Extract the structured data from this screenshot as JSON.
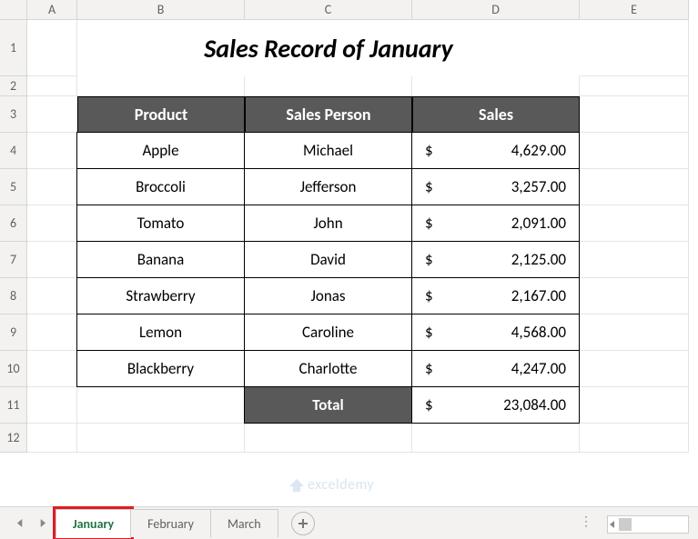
{
  "columns": [
    "A",
    "B",
    "C",
    "D",
    "E"
  ],
  "rows": [
    "1",
    "2",
    "3",
    "4",
    "5",
    "6",
    "7",
    "8",
    "9",
    "10",
    "11",
    "12"
  ],
  "title": "Sales Record of January",
  "headers": {
    "product": "Product",
    "person": "Sales Person",
    "sales": "Sales"
  },
  "currency": "$",
  "data": [
    {
      "product": "Apple",
      "person": "Michael",
      "sales": "4,629.00"
    },
    {
      "product": "Broccoli",
      "person": "Jefferson",
      "sales": "3,257.00"
    },
    {
      "product": "Tomato",
      "person": "John",
      "sales": "2,091.00"
    },
    {
      "product": "Banana",
      "person": "David",
      "sales": "2,125.00"
    },
    {
      "product": "Strawberry",
      "person": "Jonas",
      "sales": "2,167.00"
    },
    {
      "product": "Lemon",
      "person": "Caroline",
      "sales": "4,568.00"
    },
    {
      "product": "Blackberry",
      "person": "Charlotte",
      "sales": "4,247.00"
    }
  ],
  "total": {
    "label": "Total",
    "value": "23,084.00"
  },
  "tabs": [
    {
      "label": "January",
      "active": true,
      "outlined": true
    },
    {
      "label": "February",
      "active": false,
      "outlined": false
    },
    {
      "label": "March",
      "active": false,
      "outlined": false
    }
  ],
  "watermark": "exceldemy"
}
